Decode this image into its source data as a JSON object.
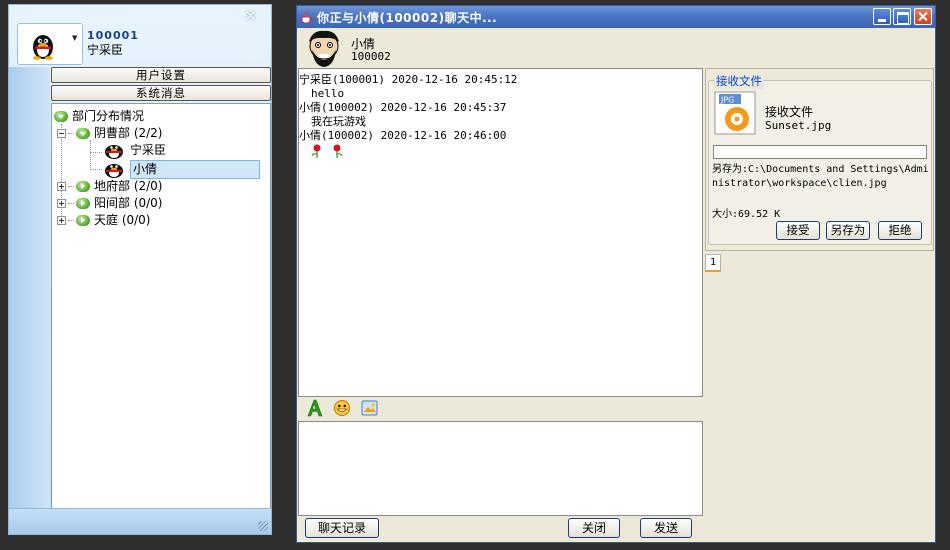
{
  "qq_panel": {
    "close_glyph": "✕",
    "my_id": "100001",
    "my_name": "宁采臣",
    "user_settings_label": "用户设置",
    "system_messages_label": "系统消息",
    "tree": {
      "root_label": "部门分布情况",
      "dept_yincao": "阴曹部 (2/2)",
      "member_1": "宁采臣",
      "member_2": "小倩",
      "dept_difu": "地府部 (2/0)",
      "dept_yangjian": "阳间部 (0/0)",
      "dept_tianting": "天庭 (0/0)"
    }
  },
  "chat_window": {
    "title": "你正与小倩(100002)聊天中...",
    "contact": {
      "name": "小倩",
      "id": "100002"
    },
    "messages": [
      {
        "header": "宁采臣(100001)  2020-12-16 20:45:12",
        "body": "hello"
      },
      {
        "header": "小倩(100002)  2020-12-16 20:45:37",
        "body": "我在玩游戏"
      },
      {
        "header": "小倩(100002)  2020-12-16 20:46:00",
        "body": ""
      }
    ],
    "toolbar_icons": [
      "font-icon",
      "emoji-icon",
      "image-icon"
    ],
    "buttons": {
      "chat_log": "聊天记录",
      "close": "关闭",
      "send": "发送"
    },
    "file_receive": {
      "group_title": "接收文件",
      "caption": "接收文件",
      "file_name": "Sunset.jpg",
      "file_type_badge": "JPG",
      "progress": 0,
      "save_path": "另存为:C:\\Documents and Settings\\Administrator\\workspace\\clien.jpg",
      "file_size": "大小:69.52 K",
      "accept": "接受",
      "save_as": "另存为",
      "reject": "拒绝"
    },
    "tab_label": "1"
  },
  "colors": {
    "titlebar": "#3b66b6",
    "link_blue": "#0046d5",
    "id_blue": "#1a3f88",
    "tree_icon_green": "#4aa524"
  }
}
